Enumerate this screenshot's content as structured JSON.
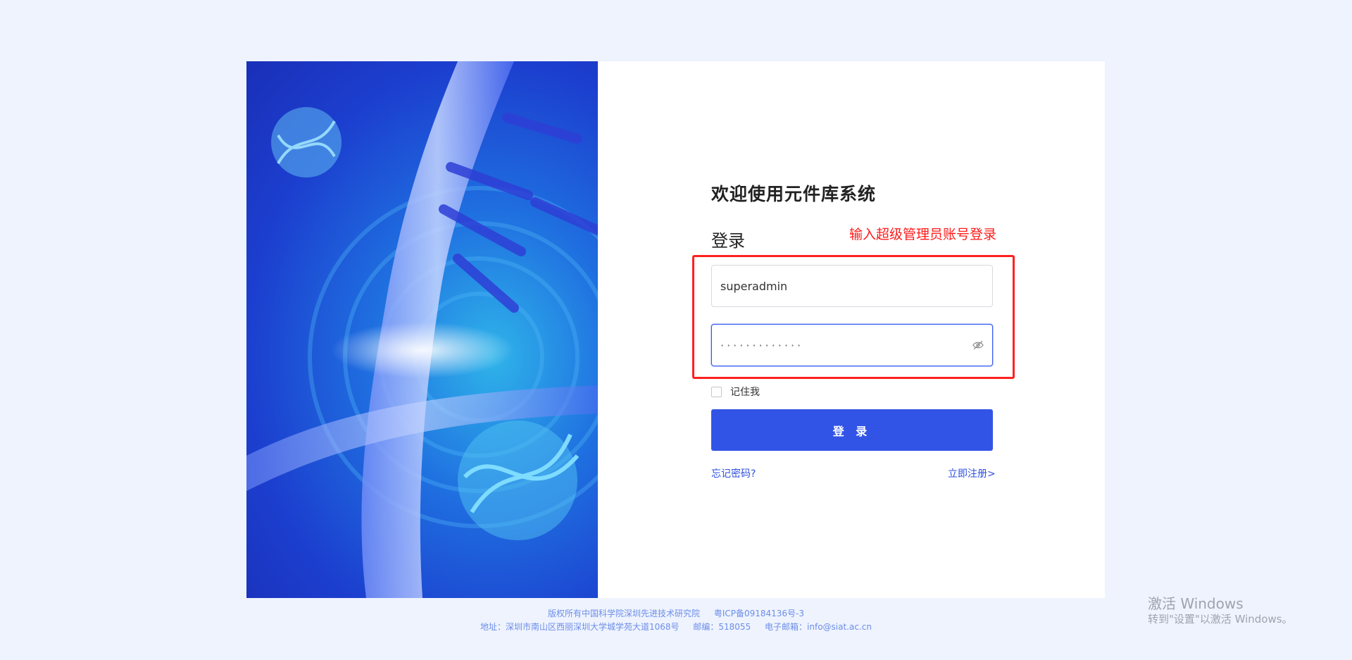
{
  "header": {
    "welcome_title": "欢迎使用元件库系统",
    "login_heading": "登录"
  },
  "annotation": {
    "text": "输入超级管理员账号登录",
    "color": "#ff2020"
  },
  "form": {
    "username_value": "superadmin",
    "password_value": "·············",
    "remember_label": "记住我",
    "login_button_label": "登 录",
    "forgot_password_label": "忘记密码?",
    "register_label": "立即注册>"
  },
  "footer": {
    "copyright": "版权所有中国科学院深圳先进技术研究院",
    "icp": "粤ICP备09184136号-3",
    "address": "地址：深圳市南山区西丽深圳大学城学苑大道1068号",
    "postcode": "邮编：518055",
    "email": "电子邮箱：info@siat.ac.cn"
  },
  "windows_watermark": {
    "title": "激活 Windows",
    "subtitle": "转到\"设置\"以激活 Windows。"
  },
  "colors": {
    "accent": "#3254e6",
    "background": "#eef3fe",
    "link": "#2d4fe0"
  }
}
